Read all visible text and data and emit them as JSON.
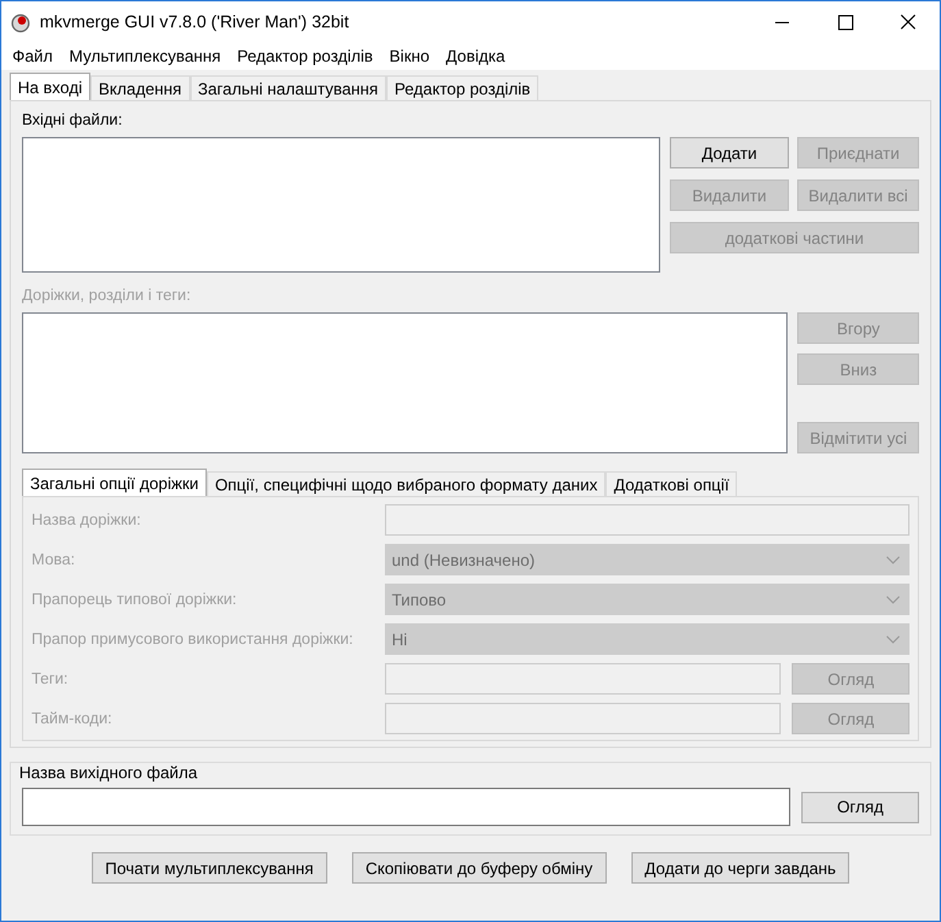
{
  "window": {
    "title": "mkvmerge GUI v7.8.0 ('River Man') 32bit"
  },
  "menu": [
    "Файл",
    "Мультиплексування",
    "Редактор розділів",
    "Вікно",
    "Довідка"
  ],
  "tabs": [
    {
      "label": "На вході",
      "selected": true
    },
    {
      "label": "Вкладення",
      "selected": false
    },
    {
      "label": "Загальні налаштування",
      "selected": false
    },
    {
      "label": "Редактор розділів",
      "selected": false
    }
  ],
  "input_files": {
    "label": "Вхідні файли:",
    "disabled": false,
    "buttons": [
      {
        "label": "Додати",
        "disabled": false,
        "wide": false
      },
      {
        "label": "Приєднати",
        "disabled": true,
        "wide": false
      },
      {
        "label": "Видалити",
        "disabled": true,
        "wide": false
      },
      {
        "label": "Видалити всі",
        "disabled": true,
        "wide": false
      },
      {
        "label": "додаткові частини",
        "disabled": true,
        "wide": true
      }
    ]
  },
  "tracks": {
    "label": "Доріжки, розділи і теги:",
    "disabled": true,
    "buttons": [
      {
        "label": "Вгору",
        "disabled": true
      },
      {
        "label": "Вниз",
        "disabled": true
      },
      {
        "label": "Відмітити усі",
        "disabled": true
      }
    ]
  },
  "track_tabs": [
    {
      "label": "Загальні опції доріжки",
      "selected": true
    },
    {
      "label": "Опції, специфічні щодо вибраного формату даних",
      "selected": false
    },
    {
      "label": "Додаткові опції",
      "selected": false
    }
  ],
  "track_options": [
    {
      "kind": "text",
      "label": "Назва доріжки:",
      "disabled": true
    },
    {
      "kind": "select",
      "label": "Мова:",
      "value": "und (Невизначено)",
      "disabled": true
    },
    {
      "kind": "select",
      "label": "Прапорець типової доріжки:",
      "value": "Типово",
      "disabled": true
    },
    {
      "kind": "select",
      "label": "Прапор примусового використання доріжки:",
      "value": "Ні",
      "disabled": true
    },
    {
      "kind": "file",
      "label": "Теги:",
      "button": "Огляд",
      "disabled": true
    },
    {
      "kind": "file",
      "label": "Тайм-коди:",
      "button": "Огляд",
      "disabled": true
    }
  ],
  "output": {
    "label": "Назва вихідного файла",
    "button": "Огляд"
  },
  "actions": [
    "Почати мультиплексування",
    "Скопіювати до буферу обміну",
    "Додати до черги завдань"
  ]
}
